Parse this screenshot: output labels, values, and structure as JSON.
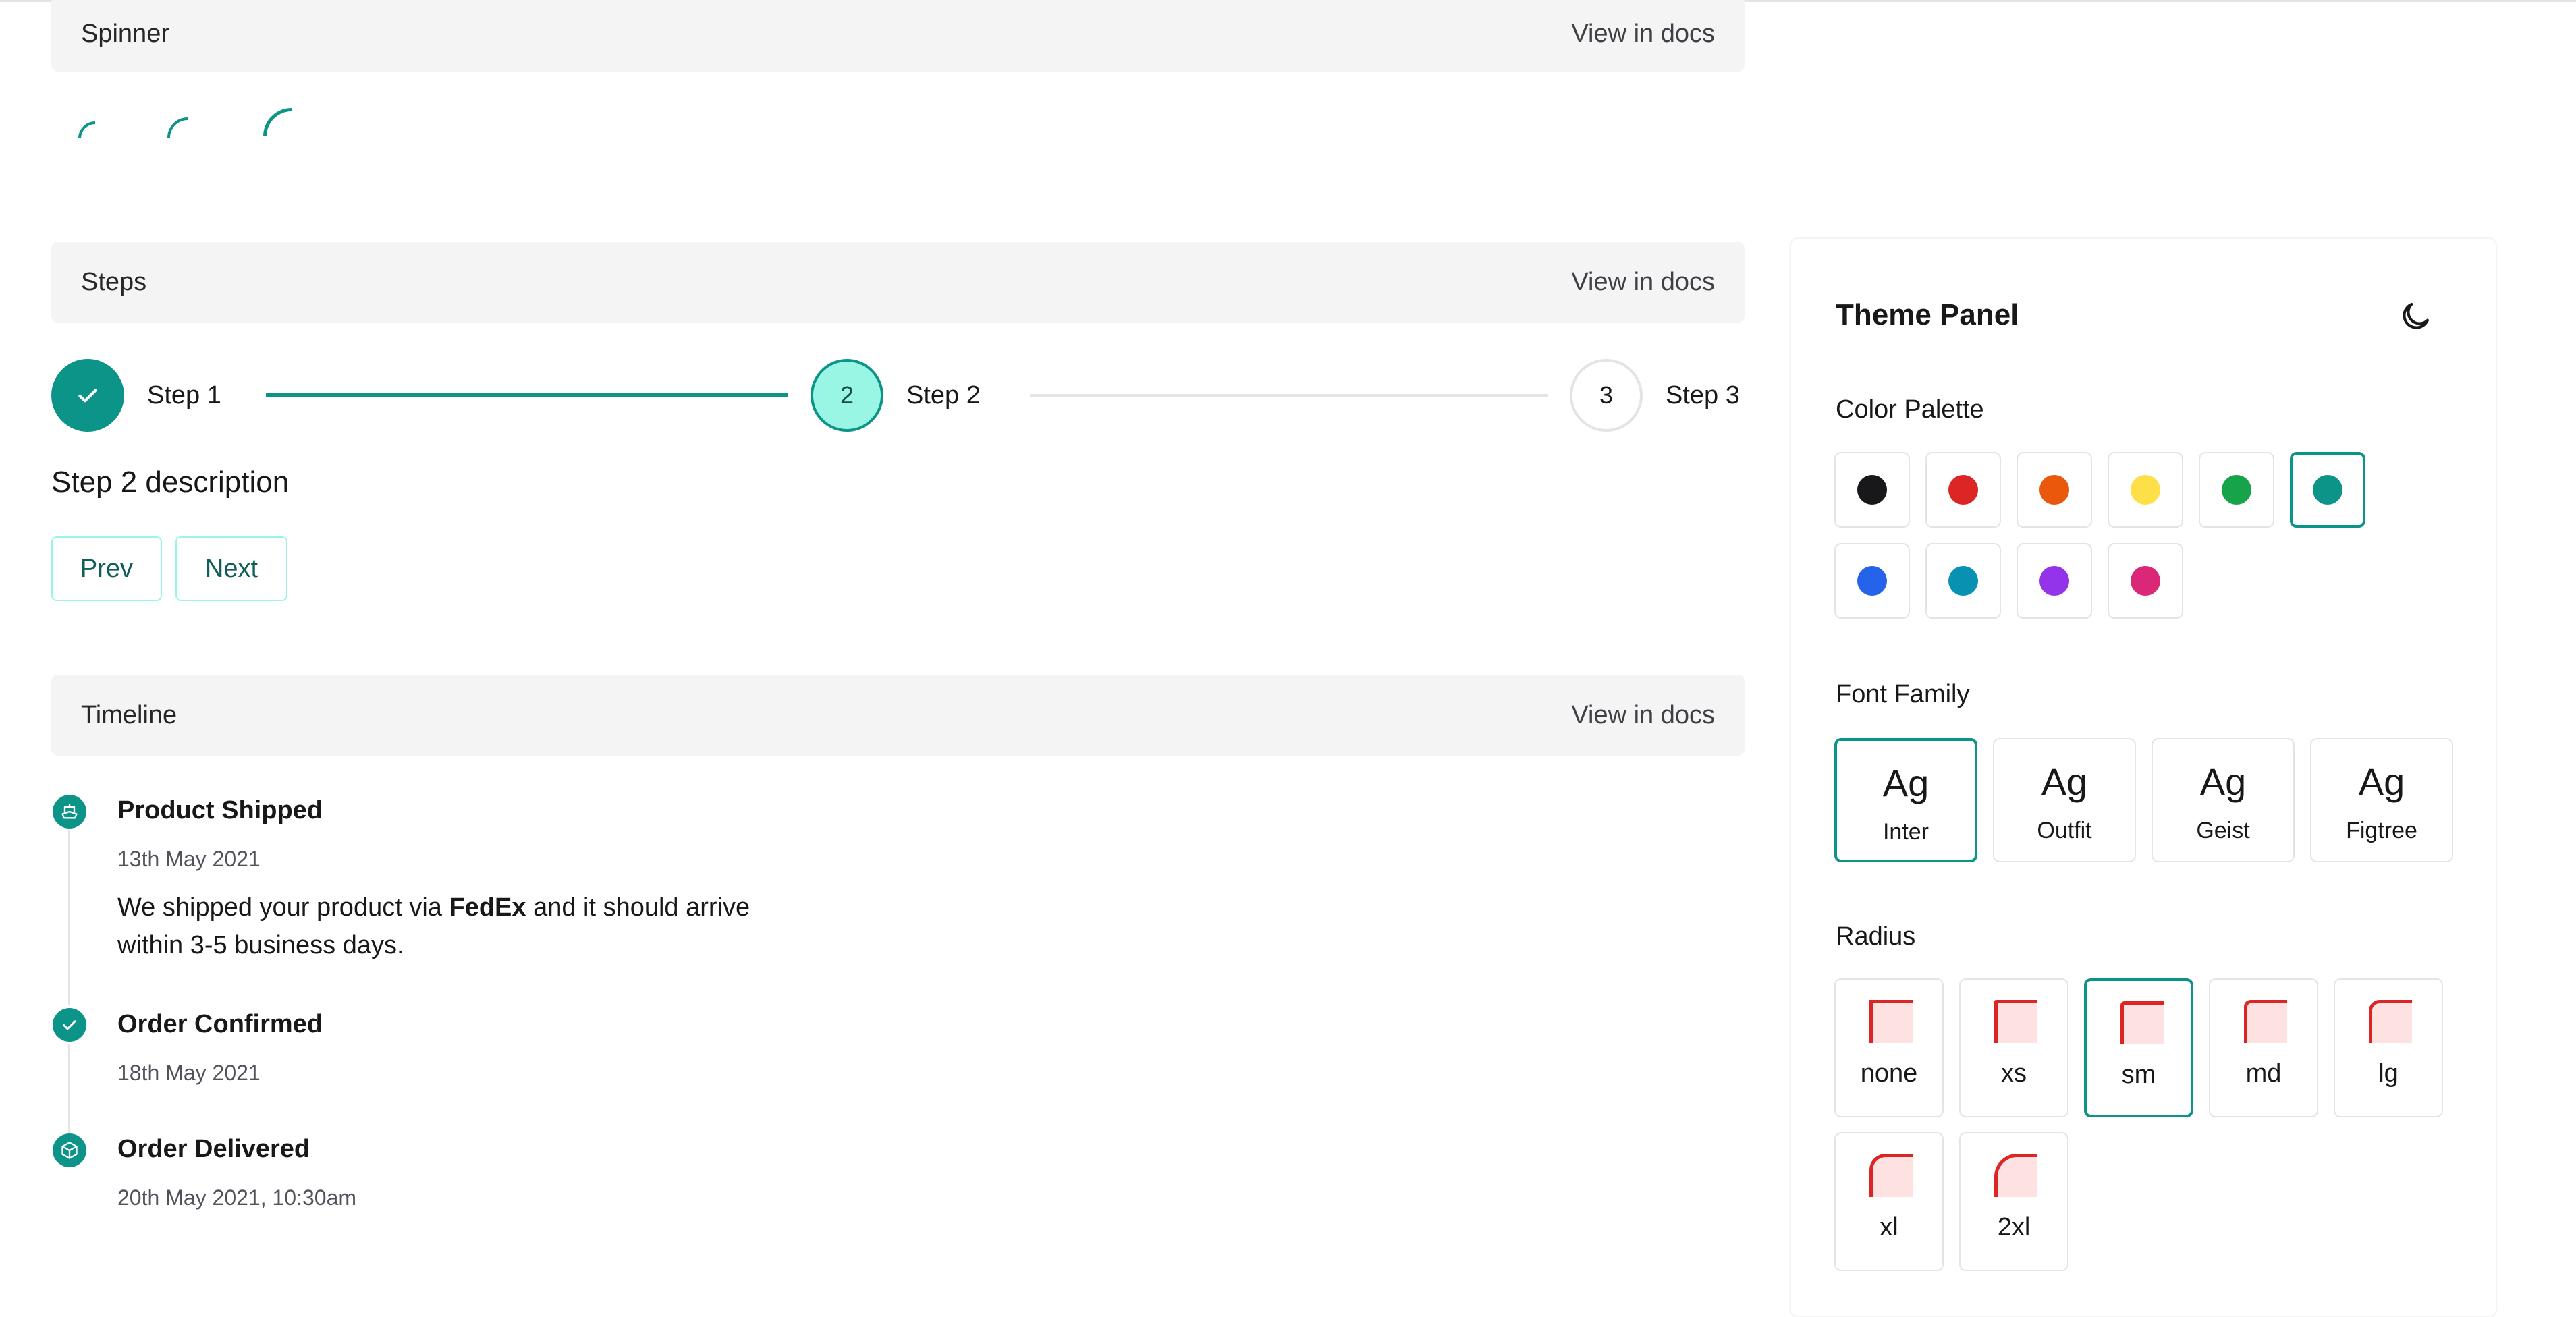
{
  "spinner": {
    "title": "Spinner",
    "docs": "View in docs"
  },
  "steps": {
    "title": "Steps",
    "docs": "View in docs",
    "items": [
      {
        "label": "Step 1",
        "indicator": "check-icon",
        "state": "complete"
      },
      {
        "label": "Step 2",
        "indicator": "2",
        "state": "current"
      },
      {
        "label": "Step 3",
        "indicator": "3",
        "state": "upcoming"
      }
    ],
    "description": "Step 2 description",
    "prev_label": "Prev",
    "next_label": "Next"
  },
  "timeline": {
    "title": "Timeline",
    "docs": "View in docs",
    "items": [
      {
        "icon": "ship-icon",
        "title": "Product Shipped",
        "date": "13th May 2021",
        "desc_before": "We shipped your product via ",
        "desc_bold": "FedEx",
        "desc_after": " and it should arrive within 3-5 business days."
      },
      {
        "icon": "check-icon",
        "title": "Order Confirmed",
        "date": "18th May 2021"
      },
      {
        "icon": "package-icon",
        "title": "Order Delivered",
        "date": "20th May 2021, 10:30am"
      }
    ]
  },
  "theme_panel": {
    "title": "Theme Panel",
    "mode_icon": "moon-icon",
    "color_palette_label": "Color Palette",
    "colors": [
      "#18181b",
      "#dc2626",
      "#ea580c",
      "#fde047",
      "#16a34a",
      "#0d9488",
      "#2563eb",
      "#0891b2",
      "#9333ea",
      "#db2777"
    ],
    "selected_color": "#0d9488",
    "font_family_label": "Font Family",
    "fonts": [
      {
        "sample": "Ag",
        "name": "Inter"
      },
      {
        "sample": "Ag",
        "name": "Outfit"
      },
      {
        "sample": "Ag",
        "name": "Geist"
      },
      {
        "sample": "Ag",
        "name": "Figtree"
      }
    ],
    "selected_font": "Inter",
    "radius_label": "Radius",
    "radii": [
      "none",
      "xs",
      "sm",
      "md",
      "lg",
      "xl",
      "2xl"
    ],
    "selected_radius": "sm"
  },
  "colors": {
    "accent": "#0d9488",
    "accent_light": "#99f6e4"
  }
}
